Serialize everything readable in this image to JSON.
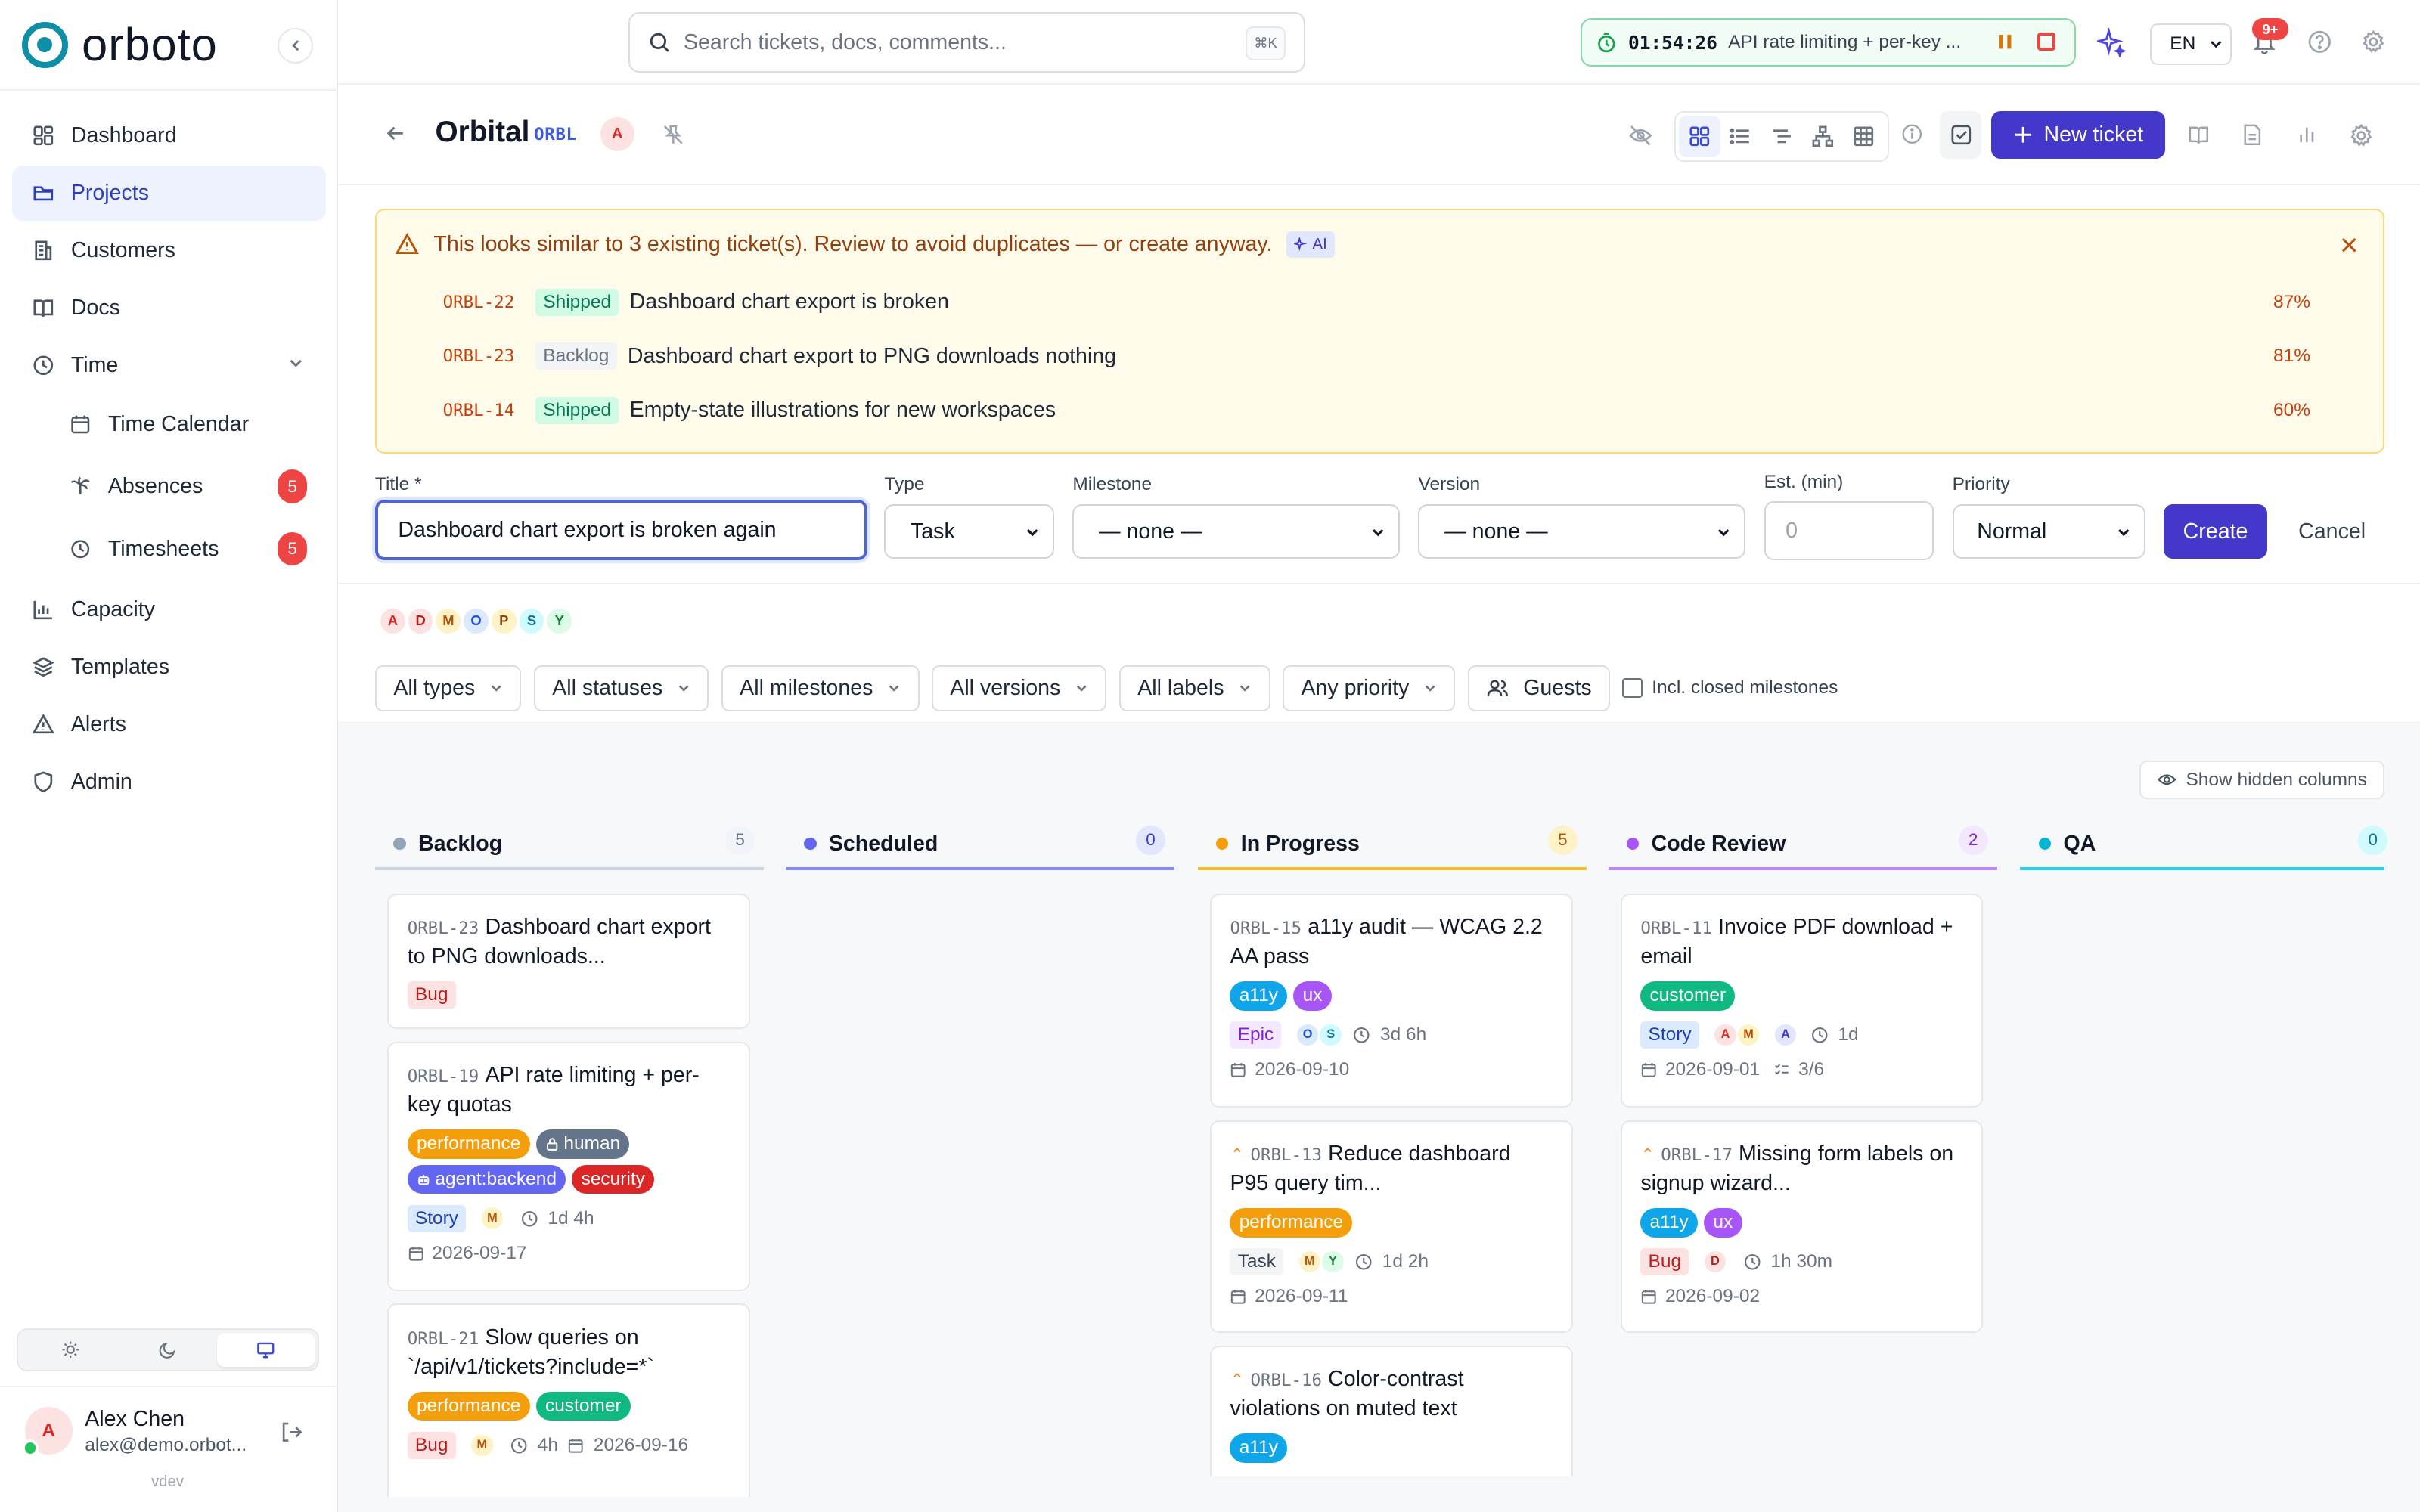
{
  "app": {
    "name": "orboto"
  },
  "sidebar": {
    "items": [
      {
        "label": "Dashboard",
        "icon": "dashboard-icon"
      },
      {
        "label": "Projects",
        "icon": "folder-icon",
        "active": true
      },
      {
        "label": "Customers",
        "icon": "building-icon"
      },
      {
        "label": "Docs",
        "icon": "book-icon"
      },
      {
        "label": "Time",
        "icon": "clock-icon",
        "expanded": true
      },
      {
        "label": "Time Calendar",
        "icon": "calendar-icon"
      },
      {
        "label": "Absences",
        "icon": "palm-icon",
        "badge": "5"
      },
      {
        "label": "Timesheets",
        "icon": "clock-icon",
        "badge": "5"
      },
      {
        "label": "Capacity",
        "icon": "bar-chart-icon"
      },
      {
        "label": "Templates",
        "icon": "layers-icon"
      },
      {
        "label": "Alerts",
        "icon": "alert-icon"
      },
      {
        "label": "Admin",
        "icon": "shield-icon"
      }
    ],
    "theme_modes": [
      "light",
      "dark",
      "system"
    ],
    "user": {
      "initial": "A",
      "name": "Alex Chen",
      "email": "alex@demo.orbot..."
    },
    "version": "vdev"
  },
  "topbar": {
    "search_placeholder": "Search tickets, docs, comments...",
    "search_shortcut": "⌘K",
    "timer": {
      "time": "01:54:26",
      "task": "API rate limiting + per-key ..."
    },
    "language": "EN",
    "notifications_badge": "9+"
  },
  "project": {
    "title": "Orbital",
    "key": "ORBL",
    "owner_initial": "A",
    "views": [
      "board",
      "list",
      "tree",
      "hierarchy",
      "table"
    ],
    "new_ticket_label": "New ticket"
  },
  "duplicate_warning": {
    "message": "This looks similar to 3 existing ticket(s). Review to avoid duplicates — or create anyway.",
    "ai_label": "AI",
    "matches": [
      {
        "key": "ORBL-22",
        "status": "Shipped",
        "title": "Dashboard chart export is broken",
        "score": "87%"
      },
      {
        "key": "ORBL-23",
        "status": "Backlog",
        "title": "Dashboard chart export to PNG downloads nothing",
        "score": "81%"
      },
      {
        "key": "ORBL-14",
        "status": "Shipped",
        "title": "Empty-state illustrations for new workspaces",
        "score": "60%"
      }
    ]
  },
  "form": {
    "title_label": "Title *",
    "title_value": "Dashboard chart export is broken again",
    "type_label": "Type",
    "type_value": "Task",
    "milestone_label": "Milestone",
    "milestone_value": "— none —",
    "version_label": "Version",
    "version_value": "— none —",
    "estimate_label": "Est. (min)",
    "estimate_placeholder": "0",
    "priority_label": "Priority",
    "priority_value": "Normal",
    "create_label": "Create",
    "cancel_label": "Cancel"
  },
  "members": [
    "A",
    "D",
    "M",
    "O",
    "P",
    "S",
    "Y"
  ],
  "filters": {
    "types": "All types",
    "statuses": "All statuses",
    "milestones": "All milestones",
    "versions": "All versions",
    "labels": "All labels",
    "priority": "Any priority",
    "guests": "Guests",
    "include_closed": "Incl. closed milestones"
  },
  "board": {
    "show_hidden_label": "Show hidden columns",
    "columns": [
      {
        "name": "Backlog",
        "count": "5",
        "color": "#94a3b8"
      },
      {
        "name": "Scheduled",
        "count": "0",
        "color": "#6366f1"
      },
      {
        "name": "In Progress",
        "count": "5",
        "color": "#f59e0b"
      },
      {
        "name": "Code Review",
        "count": "2",
        "color": "#a855f7"
      },
      {
        "name": "QA",
        "count": "0",
        "color": "#06b6d4"
      }
    ],
    "cards": {
      "backlog": [
        {
          "key": "ORBL-23",
          "title": "Dashboard chart export to PNG downloads...",
          "type": "Bug"
        },
        {
          "key": "ORBL-19",
          "title": "API rate limiting + per-key quotas",
          "labels": [
            "performance",
            "human",
            "agent:backend",
            "security"
          ],
          "type": "Story",
          "assignee": "M",
          "estimate": "1d 4h",
          "due": "2026-09-17"
        },
        {
          "key": "ORBL-21",
          "title": "Slow queries on `/api/v1/tickets?include=*`",
          "labels": [
            "performance",
            "customer"
          ],
          "type": "Bug",
          "assignee": "M",
          "estimate": "4h",
          "due": "2026-09-16"
        }
      ],
      "in_progress": [
        {
          "key": "ORBL-15",
          "title": "a11y audit — WCAG 2.2 AA pass",
          "labels": [
            "a11y",
            "ux"
          ],
          "type": "Epic",
          "assignees": [
            "O",
            "S"
          ],
          "estimate": "3d 6h",
          "due": "2026-09-10"
        },
        {
          "key": "ORBL-13",
          "title": "Reduce dashboard P95 query tim...",
          "labels": [
            "performance"
          ],
          "type": "Task",
          "assignees": [
            "M",
            "Y"
          ],
          "estimate": "1d 2h",
          "due": "2026-09-11"
        },
        {
          "key": "ORBL-16",
          "title": "Color-contrast violations on muted text",
          "labels": [
            "a11y"
          ]
        }
      ],
      "code_review": [
        {
          "key": "ORBL-11",
          "title": "Invoice PDF download + email",
          "labels": [
            "customer"
          ],
          "type": "Story",
          "assignees": [
            "A",
            "M"
          ],
          "reviewer": "A",
          "estimate": "1d",
          "due": "2026-09-01",
          "checklist": "3/6"
        },
        {
          "key": "ORBL-17",
          "title": "Missing form labels on signup wizard...",
          "labels": [
            "a11y",
            "ux"
          ],
          "type": "Bug",
          "assignee": "D",
          "estimate": "1h 30m",
          "due": "2026-09-02"
        }
      ]
    }
  },
  "colors": {
    "accent": "#4338ca",
    "performance": "#f59e0b",
    "human": "#64748b",
    "agent": "#6366f1",
    "security": "#dc2626",
    "customer": "#10b981",
    "a11y": "#0ea5e9",
    "ux": "#a855f7"
  }
}
